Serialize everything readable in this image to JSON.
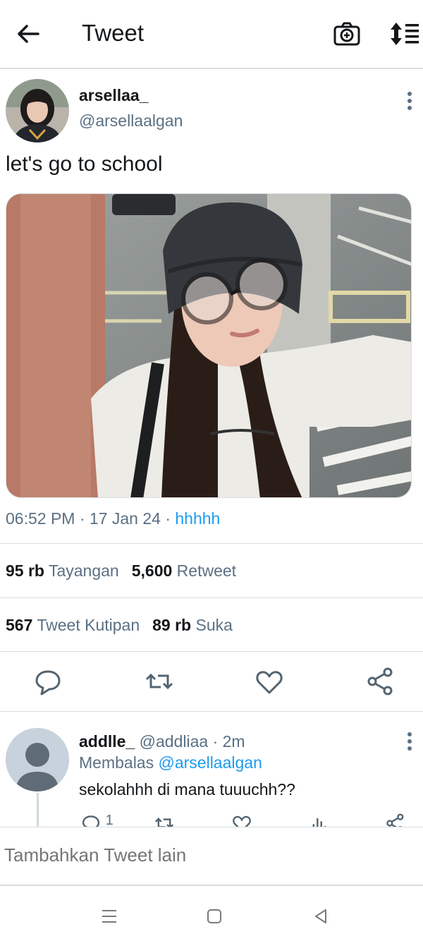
{
  "header": {
    "title": "Tweet",
    "back_icon": "arrow-left-icon",
    "camera_icon": "camera-plus-icon",
    "sort_icon": "sort-lines-icon"
  },
  "tweet": {
    "author_name": "arsellaa_",
    "author_handle": "@arsellaalgan",
    "text": "let's go to school",
    "time": "06:52 PM",
    "date": "17 Jan 24",
    "source": "hhhhh",
    "stats": {
      "views_count": "95 rb",
      "views_label": "Tayangan",
      "retweets_count": "5,600",
      "retweets_label": "Retweet",
      "quotes_count": "567",
      "quotes_label": "Tweet Kutipan",
      "likes_count": "89 rb",
      "likes_label": "Suka"
    }
  },
  "reply": {
    "name": "addlle_",
    "handle": "@addliaa",
    "time": "2m",
    "replying_prefix": "Membalas",
    "replying_to": "@arsellaalgan",
    "text": "sekolahhh di mana tuuuchh??",
    "reply_count": "1"
  },
  "compose": {
    "placeholder": "Tambahkan Tweet lain"
  },
  "colors": {
    "accent": "#1d9bf0",
    "secondary_text": "#5b7083",
    "divider": "#d9dde1"
  }
}
